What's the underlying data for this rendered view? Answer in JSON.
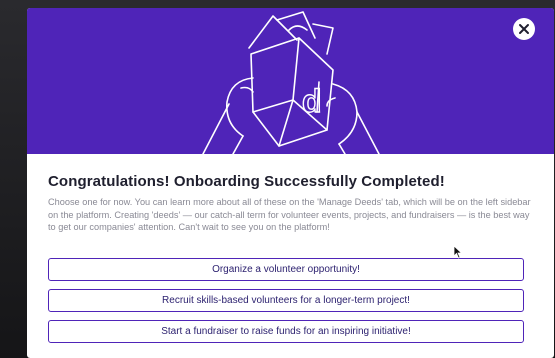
{
  "modal": {
    "title": "Congratulations! Onboarding Successfully Completed!",
    "description": "Choose one for now. You can learn more about all of these on the 'Manage Deeds' tab, which will be on the left sidebar on the platform. Creating 'deeds' — our catch-all term for volunteer events, projects, and fundraisers — is the best way to get our companies' attention. Can't wait to see you on the platform!",
    "close_icon": "close-icon",
    "hero_illustration": "hands-holding-gift-box-illustration",
    "logo_letter": "d",
    "options": [
      {
        "label": "Organize a volunteer opportunity!"
      },
      {
        "label": "Recruit skills-based volunteers for a longer-term project!"
      },
      {
        "label": "Start a fundraiser to raise funds for an inspiring initiative!"
      }
    ]
  },
  "colors": {
    "hero_background": "#4f24b8",
    "button_border": "#4f24b8",
    "button_text": "#2d2270",
    "title": "#1f1f2e",
    "description": "#8a8a95"
  }
}
